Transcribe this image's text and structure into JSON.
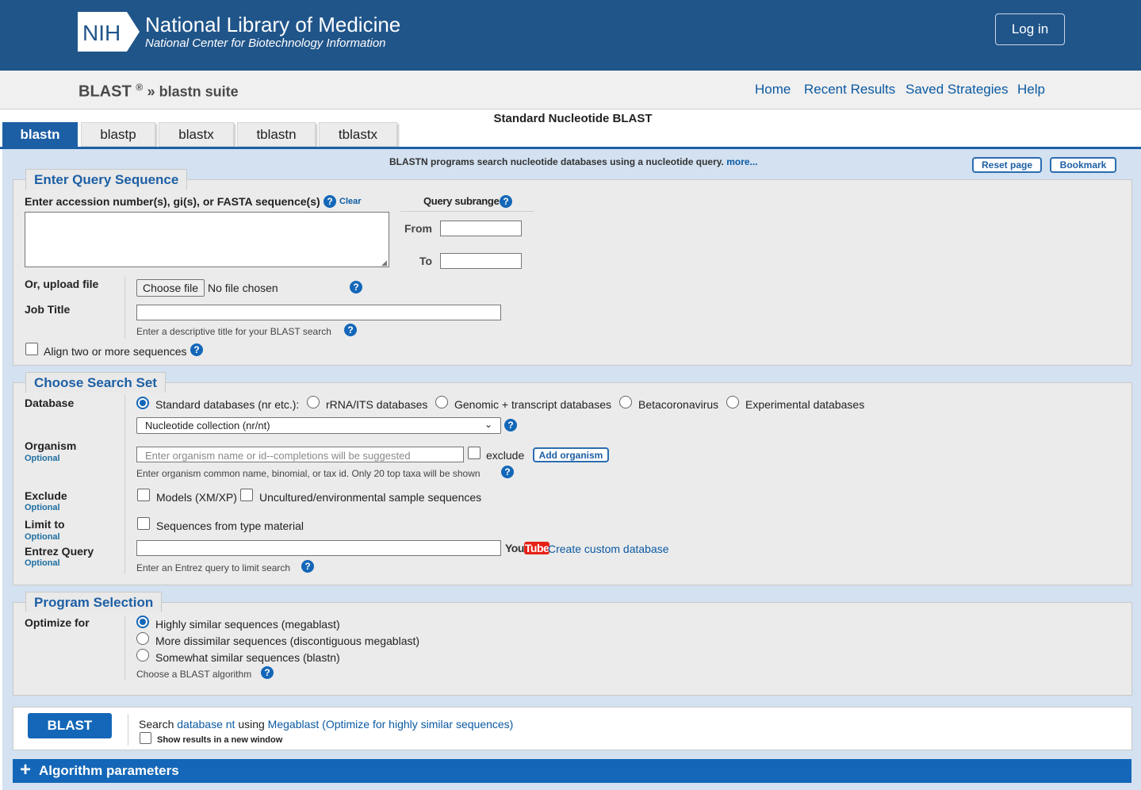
{
  "header": {
    "logo_text": "NIH",
    "title": "National Library of Medicine",
    "subtitle": "National Center for Biotechnology Information",
    "login_label": "Log in"
  },
  "breadcrumb": {
    "blast": "BLAST",
    "reg": "®",
    "suite": "» blastn suite"
  },
  "nav": {
    "home": "Home",
    "recent": "Recent Results",
    "saved": "Saved Strategies",
    "help": "Help"
  },
  "page_heading": "Standard Nucleotide BLAST",
  "tabs": [
    {
      "label": "blastn",
      "active": true
    },
    {
      "label": "blastp"
    },
    {
      "label": "blastx"
    },
    {
      "label": "tblastn"
    },
    {
      "label": "tblastx"
    }
  ],
  "intro": {
    "text": "BLASTN programs search nucleotide databases using a nucleotide query.",
    "more": "more...",
    "reset": "Reset page",
    "bookmark": "Bookmark"
  },
  "query": {
    "legend": "Enter Query Sequence",
    "label": "Enter accession number(s), gi(s), or FASTA sequence(s)",
    "clear": "Clear",
    "value": "",
    "subrange_title": "Query subrange",
    "from_label": "From",
    "to_label": "To",
    "upload_label": "Or, upload file",
    "choose_file": "Choose file",
    "no_file": "No file chosen",
    "job_title_label": "Job Title",
    "job_title_hint": "Enter a descriptive title for your BLAST search",
    "align_label": "Align two or more sequences"
  },
  "search_set": {
    "legend": "Choose Search Set",
    "database_label": "Database",
    "db_options": [
      {
        "label": "Standard databases (nr etc.):",
        "selected": true
      },
      {
        "label": "rRNA/ITS databases"
      },
      {
        "label": "Genomic + transcript databases"
      },
      {
        "label": "Betacoronavirus"
      },
      {
        "label": "Experimental databases"
      }
    ],
    "db_select": "Nucleotide collection (nr/nt)",
    "organism_label": "Organism",
    "optional": "Optional",
    "organism_placeholder": "Enter organism name or id--completions will be suggested",
    "exclude_word": "exclude",
    "add_organism": "Add organism",
    "organism_hint": "Enter organism common name, binomial, or tax id. Only 20 top taxa will be shown",
    "exclude_label": "Exclude",
    "exclude_models": "Models (XM/XP)",
    "exclude_uncultured": "Uncultured/environmental sample sequences",
    "limit_label": "Limit to",
    "limit_type": "Sequences from type material",
    "entrez_label": "Entrez Query",
    "youtube_you": "You",
    "youtube_tube": "Tube",
    "create_db": "Create custom database",
    "entrez_hint": "Enter an Entrez query to limit search"
  },
  "program": {
    "legend": "Program Selection",
    "optimize_label": "Optimize for",
    "options": [
      {
        "label": "Highly similar sequences (megablast)",
        "selected": true
      },
      {
        "label": "More dissimilar sequences (discontiguous megablast)"
      },
      {
        "label": "Somewhat similar sequences (blastn)"
      }
    ],
    "hint": "Choose a BLAST algorithm"
  },
  "submit": {
    "button": "BLAST",
    "search_prefix": "Search",
    "database": "database nt",
    "using": "using",
    "program": "Megablast (Optimize for highly similar sequences)",
    "new_window": "Show results in a new window"
  },
  "algorithm_params": "Algorithm parameters",
  "help_glyph": "?",
  "colors": {
    "header_bg": "#20558a",
    "accent": "#1467b8",
    "panel_bg": "#ebebeb",
    "main_bg": "#d3e1f1"
  }
}
